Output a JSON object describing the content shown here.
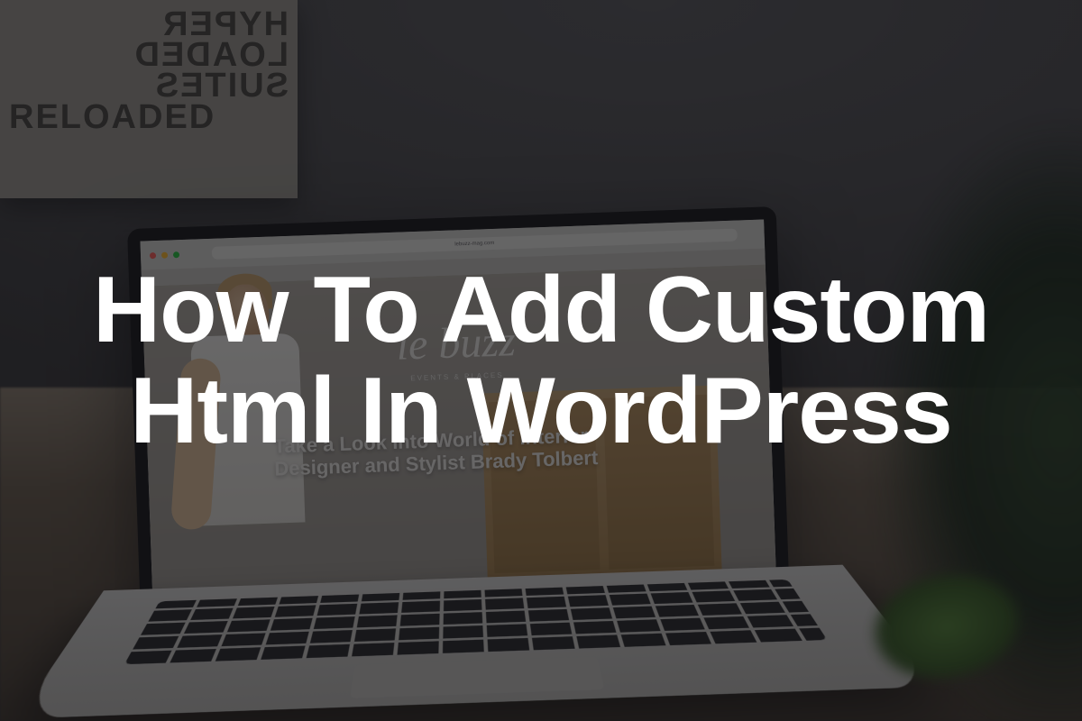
{
  "overlay": {
    "title": "How To Add Custom Html In WordPress"
  },
  "poster": {
    "line1": "HYPER",
    "line2": "LOADED",
    "line3": "SUITES",
    "line4": "RELOADED"
  },
  "laptop": {
    "address_bar": "lebuzz-mag.com",
    "site_logo": "le buzz",
    "site_subtitle": "EVENTS & PLACES",
    "article_headline": "Take a Look into World of Interior Designer and Stylist Brady Tolbert"
  }
}
